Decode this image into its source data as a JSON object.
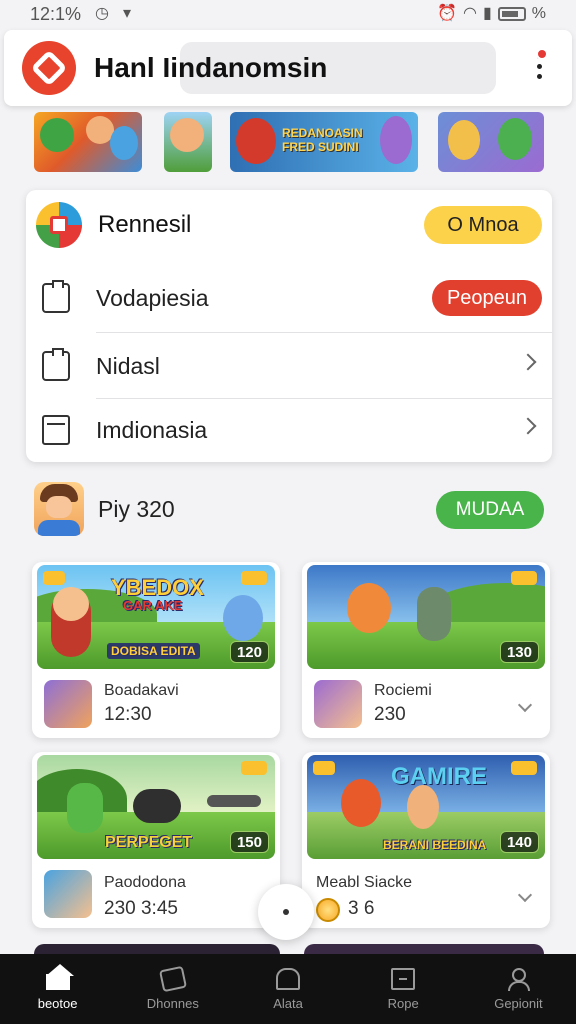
{
  "status_bar": {
    "time": "12:1%",
    "battery_text": "%"
  },
  "header": {
    "title": "Hanl Iindanomsin"
  },
  "thumbnails": {
    "banner_text_1": "REDANOASIN",
    "banner_text_2": "FRED SUDINI"
  },
  "menu": {
    "head": {
      "title": "Rennesil",
      "badge_label": "O Mnoa"
    },
    "rows": [
      {
        "label": "Vodapiesia",
        "action_label": "Peopeun"
      },
      {
        "label": "Nidasl"
      },
      {
        "label": "Imdionasia"
      }
    ]
  },
  "profile": {
    "name": "Piy 320",
    "action_label": "MUDAA"
  },
  "games": [
    {
      "image_title": "YBEDOX",
      "image_subtitle": "GAR AKE",
      "image_banner": "DOBISA EDITA",
      "badge": "120",
      "title": "Boadakavi",
      "subtitle": "12:30"
    },
    {
      "badge": "130",
      "title": "Rociemi",
      "subtitle": "230"
    },
    {
      "image_banner": "PERPEGET",
      "badge": "150",
      "title": "Paododona",
      "subtitle": "230 3:45"
    },
    {
      "image_title": "GAMIRE",
      "image_banner": "BERANI BEEDINA",
      "badge": "140",
      "title": "Meabl Siacke",
      "subtitle": "3 6"
    }
  ],
  "nav": {
    "items": [
      {
        "label": "beotoe",
        "icon": "home-icon"
      },
      {
        "label": "Dhonnes",
        "icon": "game-icon"
      },
      {
        "label": "Alata",
        "icon": "store-icon"
      },
      {
        "label": "Rope",
        "icon": "box-icon"
      },
      {
        "label": "Gepionit",
        "icon": "user-icon"
      }
    ]
  },
  "colors": {
    "accent_red": "#e1402f",
    "accent_yellow": "#fbd24a",
    "accent_green": "#48b44a",
    "nav_bg": "#111111"
  }
}
